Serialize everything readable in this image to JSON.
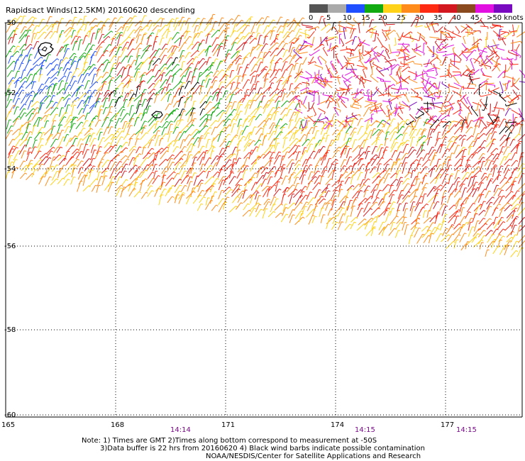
{
  "title": "Rapidsact Winds(12.5KM) 20160620 descending",
  "colorbar": {
    "unit_label": ">50 knots",
    "ticks": [
      "0",
      "5",
      "10",
      "15",
      "20",
      "25",
      "30",
      "35",
      "40",
      "45"
    ],
    "colors": [
      "#555555",
      "#aaaaaa",
      "#1f4fff",
      "#11aa11",
      "#ffd21a",
      "#ff8c1a",
      "#ff2a12",
      "#d4181f",
      "#8b4a1e",
      "#e211e2",
      "#7a0ac0"
    ]
  },
  "latitude_labels": [
    "-50",
    "-52",
    "-54",
    "-56",
    "-58",
    "-60"
  ],
  "longitude_labels": [
    "165",
    "168",
    "171",
    "174",
    "177"
  ],
  "time_labels": [
    "14:14",
    "14:15",
    "14:15"
  ],
  "notes": {
    "line1": "Note: 1) Times are GMT 2)Times along bottom correspond to measurement at -50S",
    "line2": "3)Data buffer is 22 hrs from 20160620 4) Black wind barbs indicate possible contamination",
    "line3": "NOAA/NESDIS/Center for Satellite Applications and Research"
  },
  "map_colors": {
    "grid": "#000000",
    "land": "#000000",
    "contamination": "#000000"
  }
}
